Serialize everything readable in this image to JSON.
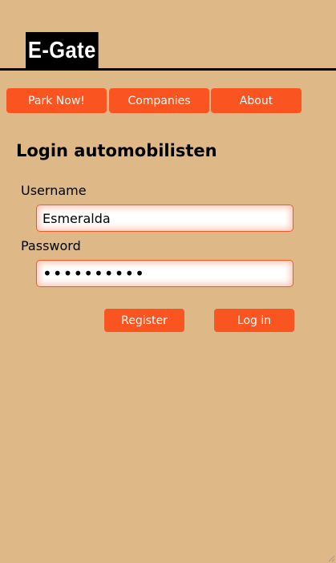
{
  "header": {
    "brand": "E-Gate"
  },
  "nav": {
    "items": [
      {
        "label": "Park Now!"
      },
      {
        "label": "Companies"
      },
      {
        "label": "About"
      }
    ]
  },
  "login": {
    "title": "Login automobilisten",
    "username_label": "Username",
    "username_value": "Esmeralda",
    "password_label": "Password",
    "password_value": "••••••••••",
    "register_label": "Register",
    "login_label": "Log in"
  },
  "colors": {
    "background": "#deb887",
    "accent": "#fa5421",
    "brand_bg": "#000000",
    "brand_text": "#ffffff"
  }
}
